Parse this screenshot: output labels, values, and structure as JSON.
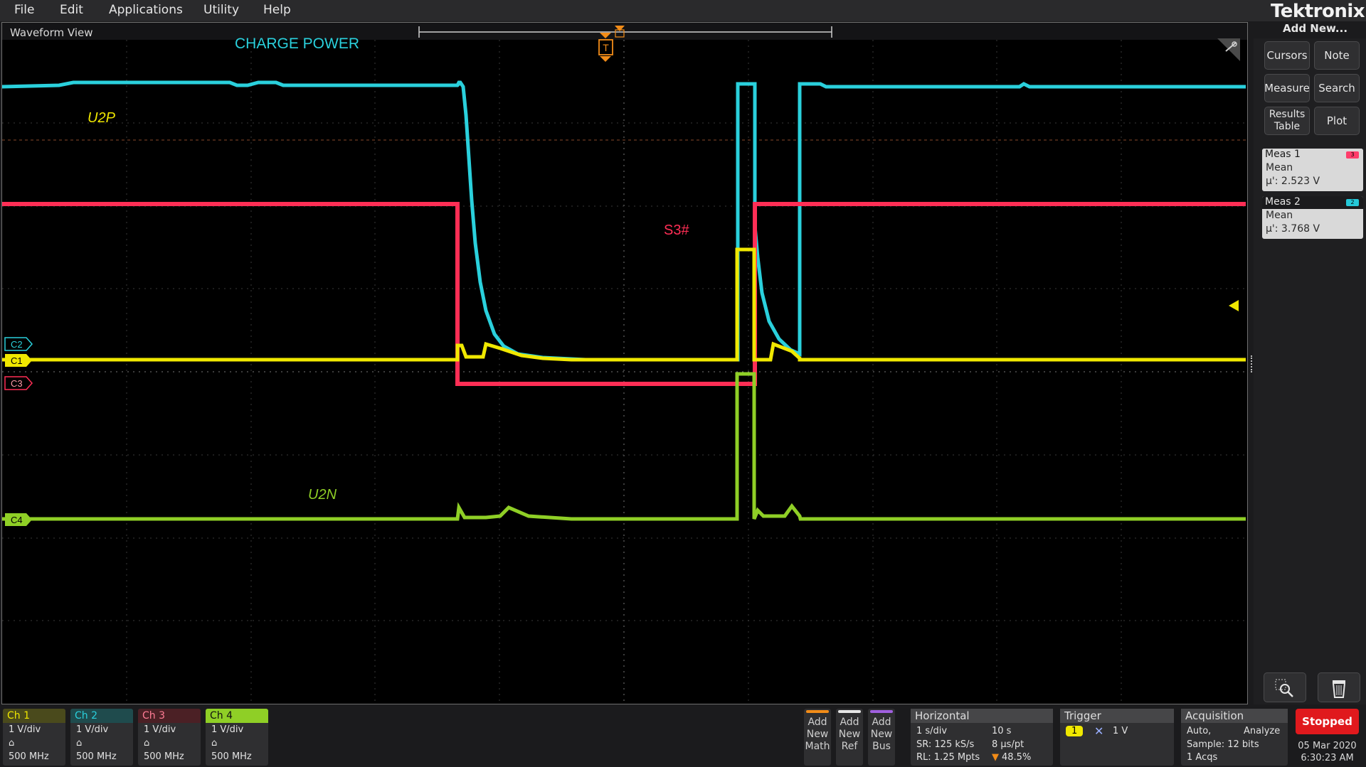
{
  "menu": [
    "File",
    "Edit",
    "Applications",
    "Utility",
    "Help"
  ],
  "brand": "Tektronix",
  "add_new": "Add New...",
  "waveform_view": {
    "title": "Waveform View",
    "labels": {
      "charge_power": "CHARGE POWER",
      "u2p": "U2P",
      "s3": "S3#",
      "u2n": "U2N"
    },
    "trigger_marker": "T",
    "channel_markers": [
      "C2",
      "C1",
      "C3",
      "C4"
    ]
  },
  "right_panel": {
    "buttons": [
      "Cursors",
      "Note",
      "Measure",
      "Search",
      "Results Table",
      "Plot"
    ],
    "measurements": [
      {
        "name": "Meas 1",
        "badge": "3",
        "type": "Mean",
        "value": "µ': 2.523 V",
        "header_color": "#d9d9d9",
        "badge_color": "#ff3d6b"
      },
      {
        "name": "Meas 2",
        "badge": "2",
        "type": "Mean",
        "value": "µ': 3.768 V",
        "header_color": "#1b1b1d",
        "badge_color": "#25c8d8"
      }
    ]
  },
  "channels": [
    {
      "name": "Ch 1",
      "vdiv": "1 V/div",
      "bw": "500 MHz",
      "color": "#f0e800",
      "header_bg": "#4a4a1c"
    },
    {
      "name": "Ch 2",
      "vdiv": "1 V/div",
      "bw": "500 MHz",
      "color": "#2ad0dc",
      "header_bg": "#1f4b4d"
    },
    {
      "name": "Ch 3",
      "vdiv": "1 V/div",
      "bw": "500 MHz",
      "color": "#ff3d6b",
      "header_bg": "#4b2025"
    },
    {
      "name": "Ch 4",
      "vdiv": "1 V/div",
      "bw": "500 MHz",
      "color": "#111111",
      "header_bg": "#8fcf26"
    }
  ],
  "add_buttons": [
    {
      "lines": [
        "Add",
        "New",
        "Math"
      ],
      "color": "#f28c18"
    },
    {
      "lines": [
        "Add",
        "New",
        "Ref"
      ],
      "color": "#e6e6e6"
    },
    {
      "lines": [
        "Add",
        "New",
        "Bus"
      ],
      "color": "#a060e0"
    }
  ],
  "horizontal": {
    "title": "Horizontal",
    "scale": "1 s/div",
    "duration": "10 s",
    "sample_rate": "SR: 125 kS/s",
    "pt_spacing": "8 µs/pt",
    "record_length": "RL: 1.25 Mpts",
    "position": "48.5%"
  },
  "trigger": {
    "title": "Trigger",
    "source": "1",
    "level": "1 V"
  },
  "acquisition": {
    "title": "Acquisition",
    "mode": "Auto,",
    "analyze": "Analyze",
    "sample": "Sample: 12 bits",
    "acqs": "1 Acqs"
  },
  "status": "Stopped",
  "date": "05 Mar 2020",
  "time": "6:30:23 AM",
  "colors": {
    "ch1": "#f0e800",
    "ch2": "#2ad0dc",
    "ch3": "#ff2e55",
    "ch4": "#8fcf26",
    "trigger": "#f28c18"
  }
}
